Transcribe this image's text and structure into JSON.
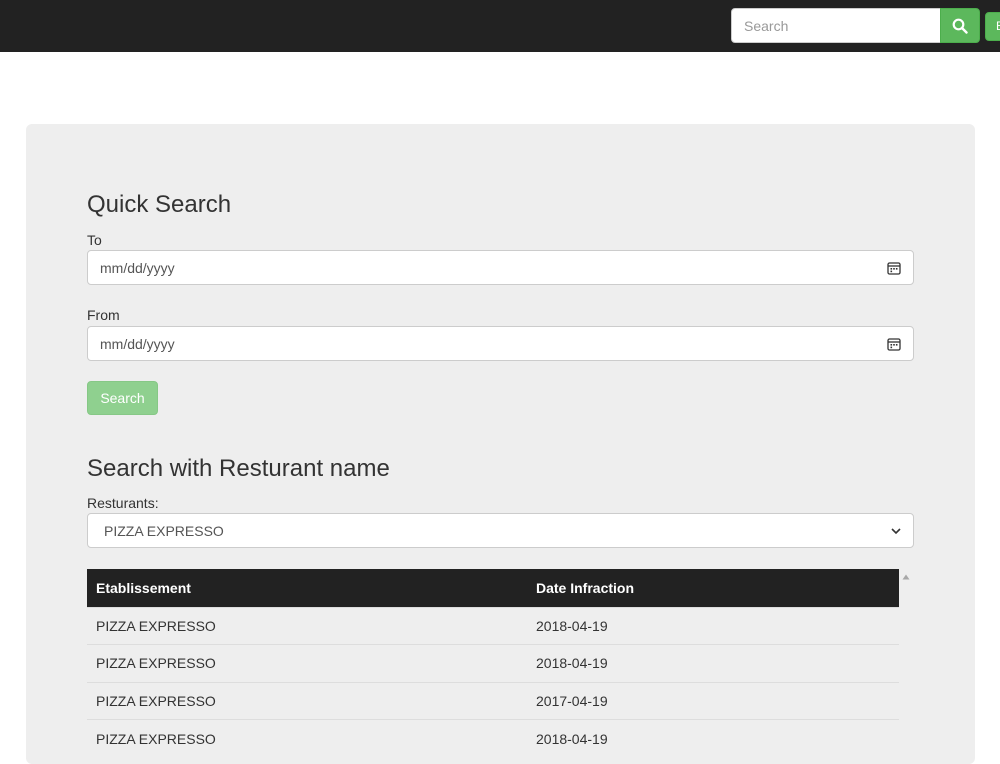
{
  "navbar": {
    "search_placeholder": "Search",
    "search_button_icon": "search-icon",
    "extra_button_label": "E"
  },
  "quick_search": {
    "title": "Quick Search",
    "to_label": "To",
    "to_value": "mm/dd/yyyy",
    "from_label": "From",
    "from_value": "mm/dd/yyyy",
    "search_button_label": "Search"
  },
  "restaurant_search": {
    "title": "Search with Resturant name",
    "select_label": "Resturants:",
    "selected_value": "PIZZA EXPRESSO"
  },
  "table": {
    "headers": [
      "Etablissement",
      "Date Infraction"
    ],
    "rows": [
      [
        "PIZZA EXPRESSO",
        "2018-04-19"
      ],
      [
        "PIZZA EXPRESSO",
        "2018-04-19"
      ],
      [
        "PIZZA EXPRESSO",
        "2017-04-19"
      ],
      [
        "PIZZA EXPRESSO",
        "2018-04-19"
      ]
    ]
  },
  "colors": {
    "navbar_bg": "#222222",
    "accent_green": "#5cb85c",
    "panel_bg": "#eeeeee"
  }
}
